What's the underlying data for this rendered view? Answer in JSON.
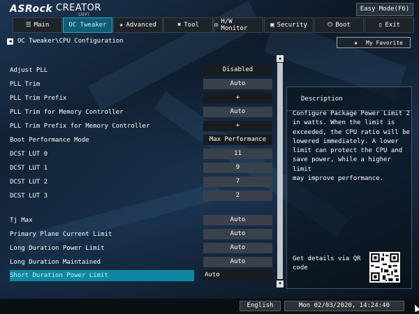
{
  "header": {
    "brand": "ASRock",
    "brand_sub": "CREATOR",
    "brand_uefi": "UEFI",
    "easy_mode": "Easy Mode(F6)"
  },
  "tabs": [
    {
      "label": "Main",
      "icon": "list-icon",
      "glyph": "☰"
    },
    {
      "label": "OC Tweaker",
      "icon": "",
      "glyph": ""
    },
    {
      "label": "Advanced",
      "icon": "star-icon",
      "glyph": "✬"
    },
    {
      "label": "Tool",
      "icon": "tool-icon",
      "glyph": "✖"
    },
    {
      "label": "H/W Monitor",
      "icon": "monitor-icon",
      "glyph": "◎"
    },
    {
      "label": "Security",
      "icon": "shield-icon",
      "glyph": "▣"
    },
    {
      "label": "Boot",
      "icon": "power-icon",
      "glyph": "⏻"
    },
    {
      "label": "Exit",
      "icon": "exit-icon",
      "glyph": "▯"
    }
  ],
  "breadcrumb": "OC Tweaker\\CPU Configuration",
  "my_favorite": "My Favorite",
  "settings": [
    {
      "label": "Adjust PLL",
      "value": "Disabled",
      "style": "dark"
    },
    {
      "label": "PLL Trim",
      "value": "Auto",
      "style": ""
    },
    {
      "label": "PLL Trim Prefix",
      "value": "+",
      "style": "dark"
    },
    {
      "label": "PLL Trim for Memory Controller",
      "value": "Auto",
      "style": ""
    },
    {
      "label": "PLL Trim Prefix for Memory Controller",
      "value": "+",
      "style": "dark"
    },
    {
      "label": "Boot Performance Mode",
      "value": "Max Performance",
      "style": "dark"
    },
    {
      "label": "DCST LUT 0",
      "value": "11",
      "style": ""
    },
    {
      "label": "DCST LUT 1",
      "value": "9",
      "style": ""
    },
    {
      "label": "DCST LUT 2",
      "value": "7",
      "style": ""
    },
    {
      "label": "DCST LUT 3",
      "value": "2",
      "style": ""
    },
    {
      "label": "Tj Max",
      "value": "Auto",
      "style": ""
    },
    {
      "label": "Primary Plane Current Limit",
      "value": "Auto",
      "style": ""
    },
    {
      "label": "Long Duration Power Limit",
      "value": "Auto",
      "style": ""
    },
    {
      "label": "Long Duration Maintained",
      "value": "Auto",
      "style": ""
    },
    {
      "label": "Short Duration Power Limit",
      "value": "Auto",
      "style": "selected"
    }
  ],
  "description": {
    "title": "Description",
    "text": "Configure Package Power Limit 2\nin watts. When the limit is\nexceeded, the CPU ratio will be\nlowered immediately. A lower\nlimit can protect the CPU and\nsave power, while a higher limit\nmay improve performance.",
    "details": "Get details via QR\ncode"
  },
  "footer": {
    "language": "English",
    "datetime": "Mon 02/03/2020, 14:24:40"
  },
  "colors": {
    "accent": "#0e88a2",
    "active_tab": "#0f5d73"
  }
}
